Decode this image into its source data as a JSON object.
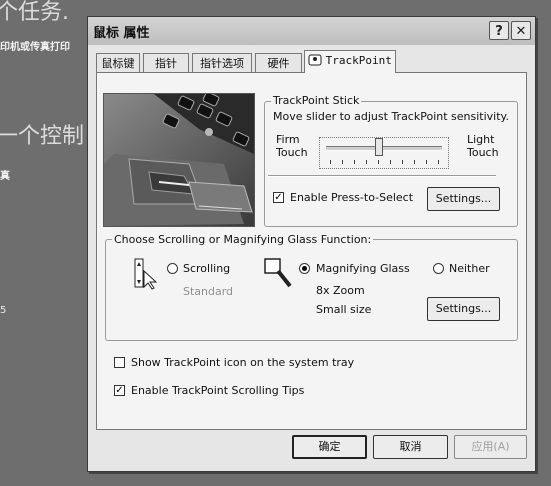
{
  "background": {
    "heading1": "个任务.",
    "line1": "印机或传真打印",
    "heading2": "一个控制",
    "line2": "真",
    "line3": "5"
  },
  "dialog": {
    "title": "鼠标 属性",
    "help_label": "?",
    "close_label": "✕"
  },
  "tabs": [
    {
      "label": "鼠标键"
    },
    {
      "label": "指针"
    },
    {
      "label": "指针选项"
    },
    {
      "label": "硬件"
    },
    {
      "label": "TrackPoint",
      "active": true
    }
  ],
  "stick": {
    "legend": "TrackPoint Stick",
    "instruction": "Move slider to adjust TrackPoint sensitivity.",
    "left_label_1": "Firm",
    "left_label_2": "Touch",
    "right_label_1": "Light",
    "right_label_2": "Touch",
    "sensitivity_position": 0.45,
    "tick_count": 10,
    "press_to_select_label": "Enable Press-to-Select",
    "press_to_select_checked": true,
    "settings_label": "Settings..."
  },
  "scroll": {
    "legend": "Choose Scrolling or Magnifying Glass Function:",
    "scrolling_label": "Scrolling",
    "scrolling_sub": "Standard",
    "magnify_label": "Magnifying Glass",
    "magnify_zoom": "8x Zoom",
    "magnify_size": "Small size",
    "neither_label": "Neither",
    "selected": "magnify",
    "settings_label": "Settings..."
  },
  "options": {
    "tray_icon_label": "Show TrackPoint icon on the system tray",
    "tray_icon_checked": false,
    "scroll_tips_label": "Enable TrackPoint Scrolling Tips",
    "scroll_tips_checked": true
  },
  "footer": {
    "ok_label": "确定",
    "cancel_label": "取消",
    "apply_label": "应用(A)"
  },
  "colors": {
    "desktop": "#6e6e6e",
    "dialog_face": "#e6e6e6",
    "panel_face": "#f4f4f4"
  }
}
